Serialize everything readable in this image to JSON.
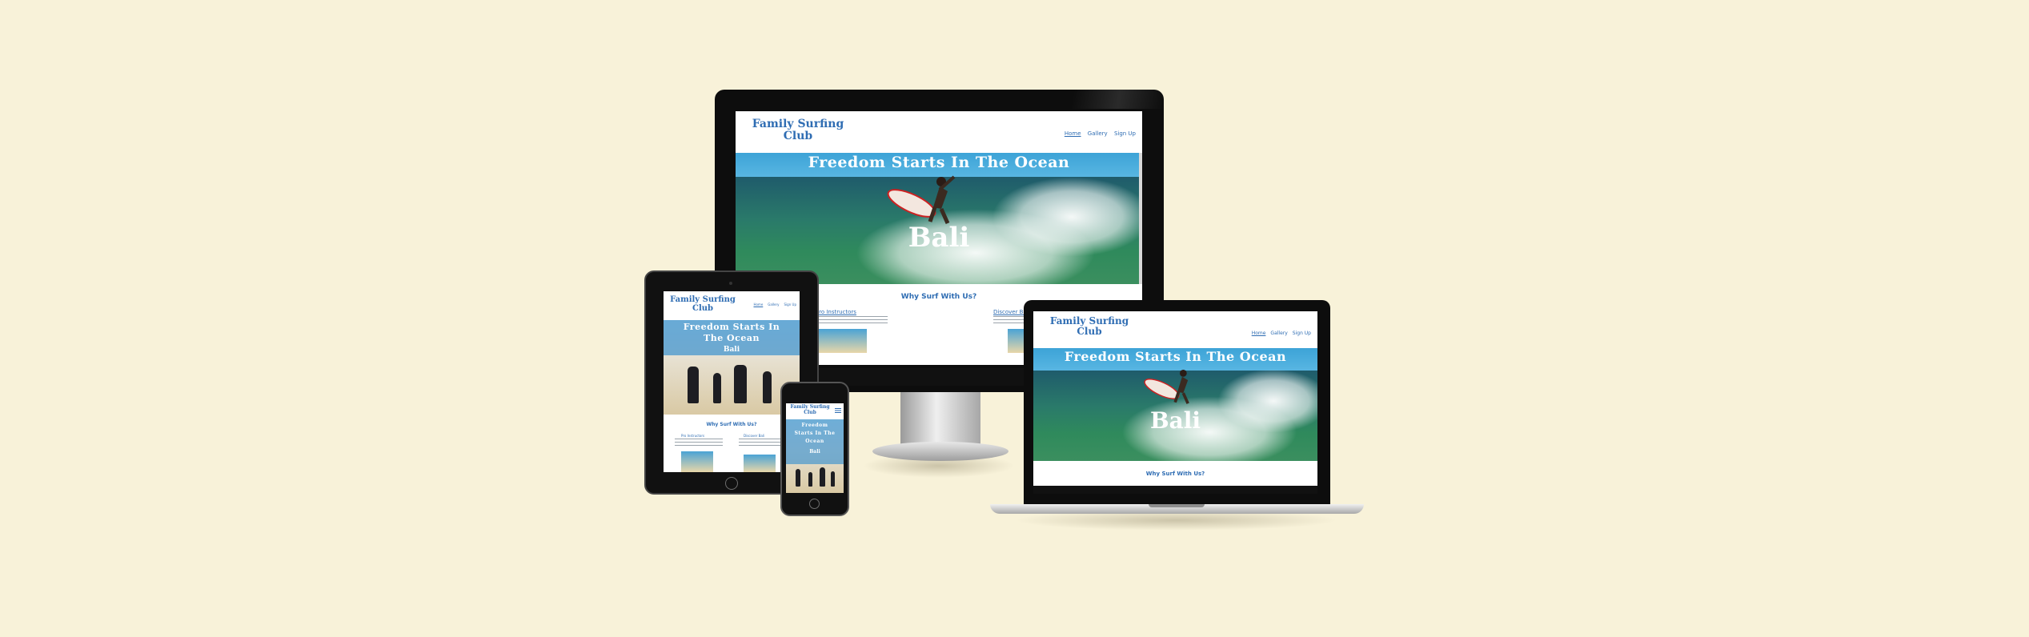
{
  "site": {
    "brand_line1": "Family Surfing",
    "brand_line2": "Club",
    "nav": [
      "Home",
      "Gallery",
      "Sign Up"
    ],
    "hero_title": "Freedom Starts In The Ocean",
    "hero_subtitle": "Bali",
    "section_title": "Why Surf With Us?",
    "feature_left": "Pro Instructors",
    "feature_right": "Discover Bali"
  },
  "mobile": {
    "hero_lines": [
      "Freedom",
      "Starts In The",
      "Ocean",
      "Bali"
    ]
  },
  "colors": {
    "background": "#f8f2d9",
    "brand_blue": "#2f6db3",
    "sky_blue": "#3da3d7",
    "device_black": "#0d0d0d"
  },
  "icons": [
    "hamburger-menu-icon",
    "home-button-icon",
    "camera-icon"
  ]
}
